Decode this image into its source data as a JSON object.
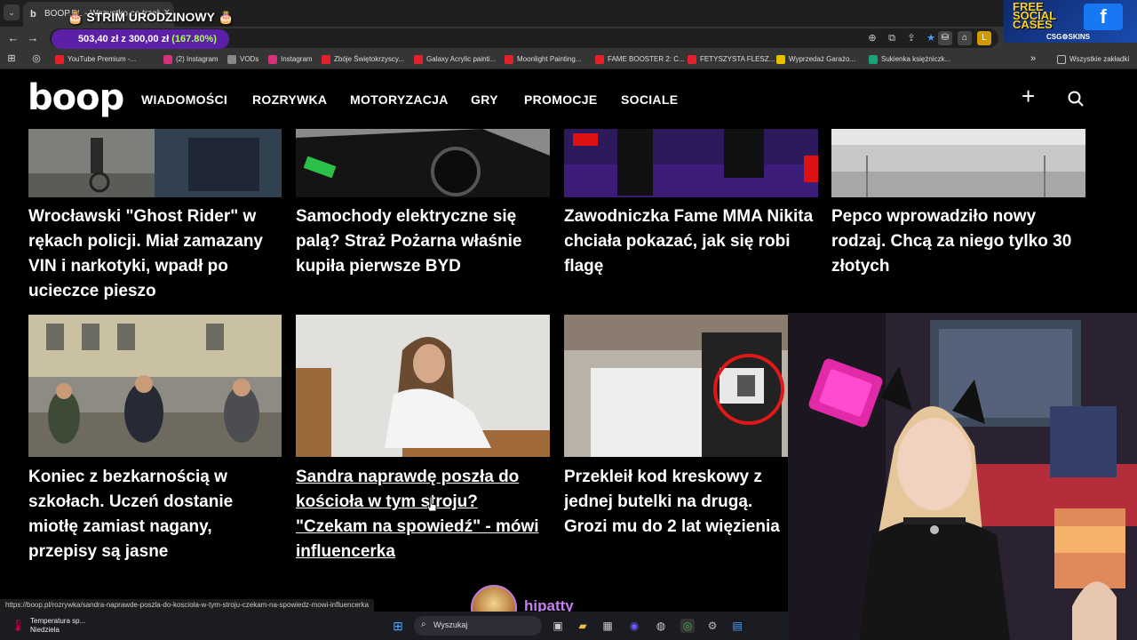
{
  "browser": {
    "tab_title": "BOOP.PL - Wszystko co trzeba",
    "stream_title": "🎂 STRIM URODZINOWY 🎂",
    "donation_text": "503,40 zł z 300,00 zł",
    "donation_pct": "(167.80%)",
    "bookmarks": [
      {
        "label": "YouTube Premium -...",
        "color": "#e4202a"
      },
      {
        "label": "(2) Instagram",
        "color": "#d6307a"
      },
      {
        "label": "VODs",
        "color": "#888888"
      },
      {
        "label": "Instagram",
        "color": "#d6307a"
      },
      {
        "label": "Zbóje Świętokrzyscy...",
        "color": "#e4202a"
      },
      {
        "label": "Galaxy Acrylic painti...",
        "color": "#e4202a"
      },
      {
        "label": "Moonlight Painting...",
        "color": "#e4202a"
      },
      {
        "label": "FAME BOOSTER 2: C...",
        "color": "#e4202a"
      },
      {
        "label": "FETYSZYSTA FLESZ...",
        "color": "#e4202a"
      },
      {
        "label": "Wyprzedaż Garażo...",
        "color": "#e6c200"
      },
      {
        "label": "Sukienka księżniczk...",
        "color": "#1aa37a"
      }
    ],
    "all_bookmarks": "Wszystkie zakładki"
  },
  "ad": {
    "line1": "FREE",
    "line2": "SOCIAL",
    "line3": "CASES",
    "brand": "CSG⚙SKINS"
  },
  "site": {
    "logo": "boop",
    "nav": [
      "WIADOMOŚCI",
      "ROZRYWKA",
      "MOTORYZACJA",
      "GRY",
      "PROMOCJE",
      "SOCIALE"
    ]
  },
  "articles": {
    "row1": [
      {
        "title": "Wrocławski \"Ghost Rider\" w rękach policji. Miał zamazany VIN i narkotyki, wpadł po ucieczce pieszo"
      },
      {
        "title": "Samochody elektryczne się palą? Straż Pożarna właśnie kupiła pierwsze BYD"
      },
      {
        "title": "Zawodniczka Fame MMA Nikita chciała pokazać, jak się robi flagę"
      },
      {
        "title": "Pepco wprowadziło nowy rodzaj. Chcą za niego tylko 30 złotych"
      }
    ],
    "row2": [
      {
        "title": "Koniec z bezkarnością w szkołach. Uczeń dostanie miotłę zamiast nagany, przepisy są jasne"
      },
      {
        "title": "Sandra naprawdę poszła do kościoła w tym stroju? \"Czekam na spowiedź\" - mówi influencerka"
      },
      {
        "title": "Przekleił kod kreskowy z jednej butelki na drugą. Grozi mu do 2 lat więzienia"
      }
    ]
  },
  "status_url": "https://boop.pl/rozrywka/sandra-naprawde-poszla-do-kosciola-w-tym-stroju-czekam-na-spowiedz-mowi-influencerka",
  "streamer": {
    "name": "hipatty"
  },
  "taskbar": {
    "weather_line1": "Temperatura sp...",
    "weather_line2": "Niedziela",
    "search_placeholder": "Wyszukaj"
  }
}
